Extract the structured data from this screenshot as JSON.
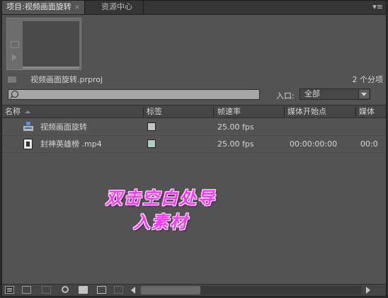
{
  "tabs": [
    {
      "label": "项目:视频画面旋转",
      "close": "×",
      "active": true
    },
    {
      "label": "资源中心",
      "active": false
    }
  ],
  "panel_menu_glyph": "▾≡",
  "project": {
    "file_name": "视频画面旋转.prproj",
    "item_count": "2 个分项"
  },
  "search": {
    "placeholder": ""
  },
  "in_point": {
    "label": "入口:",
    "selected": "全部"
  },
  "columns": [
    "名称",
    "标签",
    "帧速率",
    "媒体开始点",
    "媒体"
  ],
  "rows": [
    {
      "icon": "sequence-icon",
      "name": "视频画面旋转",
      "label_color": "#c3c3c3",
      "frame_rate": "25.00 fps",
      "media_start": "",
      "media_extra": ""
    },
    {
      "icon": "video-clip-icon",
      "name": "封神英雄榜 .mp4",
      "label_color": "#b2cbc3",
      "frame_rate": "25.00 fps",
      "media_start": "00:00:00:00",
      "media_extra": "00:0"
    }
  ],
  "overlay": {
    "line1": "双击空白处导",
    "line2": "入素材",
    "color": "#ff33ff"
  }
}
